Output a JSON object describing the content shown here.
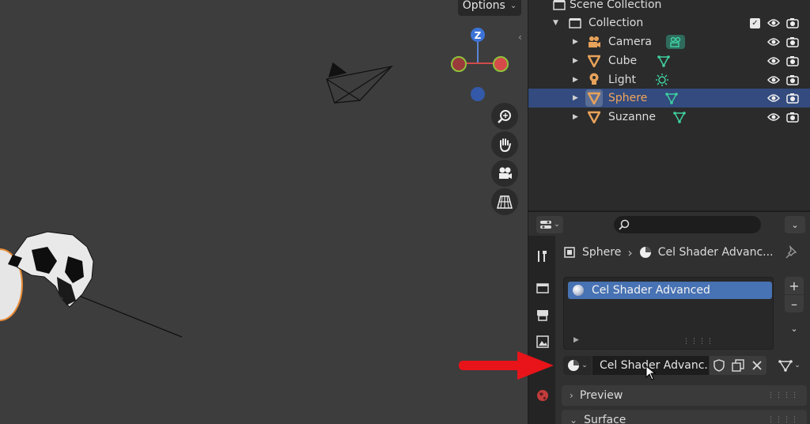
{
  "viewport": {
    "options_label": "Options",
    "gizmo_axis_label": "Z"
  },
  "outliner": {
    "root_label": "Scene Collection",
    "collection_label": "Collection",
    "items": [
      {
        "label": "Camera",
        "icon": "camera-object-icon",
        "extra_icon": "camera-data-icon"
      },
      {
        "label": "Cube",
        "icon": "mesh-object-icon",
        "extra_icon": "mesh-data-icon"
      },
      {
        "label": "Light",
        "icon": "light-object-icon",
        "extra_icon": "light-data-icon"
      },
      {
        "label": "Sphere",
        "icon": "mesh-object-icon",
        "extra_icon": "mesh-data-icon",
        "selected": true
      },
      {
        "label": "Suzanne",
        "icon": "mesh-object-icon",
        "extra_icon": "mesh-data-icon"
      }
    ]
  },
  "properties": {
    "search_placeholder": "",
    "breadcrumb": {
      "object": "Sphere",
      "material": "Cel Shader Advanc..."
    },
    "material_slots": [
      {
        "label": "Cel Shader Advanced",
        "selected": true
      }
    ],
    "material_name": "Cel Shader Advanc...",
    "panels": {
      "preview": "Preview",
      "surface": "Surface"
    }
  },
  "colors": {
    "accent_selected_row": "#334b7e",
    "slot_selected": "#4772b3",
    "active_object_text": "#f2a55b",
    "object_icon": "#e8a25a",
    "data_icon": "#3fd0a0",
    "arrow_annotation": "#e8141a"
  }
}
